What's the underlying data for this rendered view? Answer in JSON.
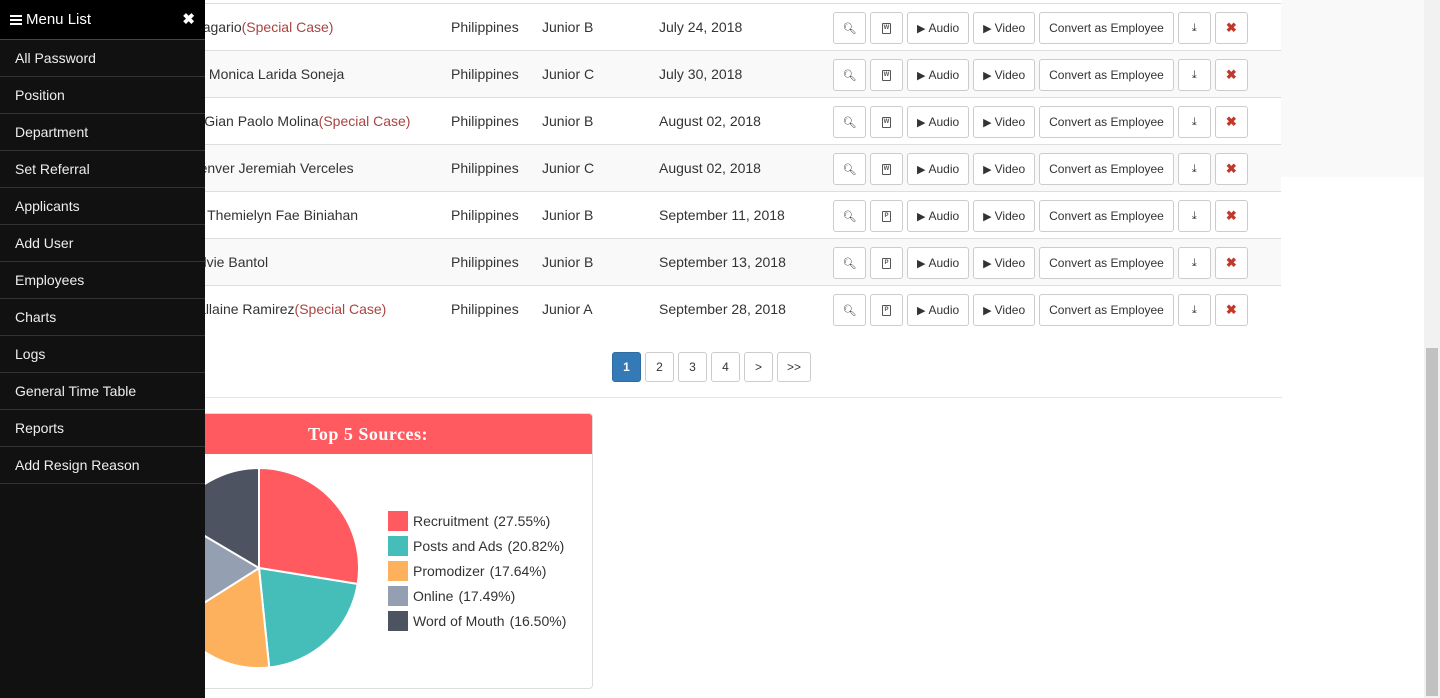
{
  "sidebar": {
    "title": "Menu List",
    "close": "✖",
    "items": [
      {
        "label": "All Password",
        "dropdown": false
      },
      {
        "label": "Position",
        "dropdown": false
      },
      {
        "label": "Department",
        "dropdown": false
      },
      {
        "label": "Set Referral",
        "dropdown": false
      },
      {
        "label": "Applicants",
        "dropdown": true
      },
      {
        "label": "Add User",
        "dropdown": false
      },
      {
        "label": "Employees",
        "dropdown": true
      },
      {
        "label": "Charts",
        "dropdown": false
      },
      {
        "label": "Logs",
        "dropdown": false
      },
      {
        "label": "General Time Table",
        "dropdown": false
      },
      {
        "label": "Reports",
        "dropdown": false
      },
      {
        "label": "Add Resign Reason",
        "dropdown": false
      }
    ]
  },
  "table": {
    "rows": [
      {
        "name": "Randy Sagario",
        "special": "(Special Case)",
        "country": "Philippines",
        "level": "Junior B",
        "date": "July 24, 2018",
        "doc": "W"
      },
      {
        "name": "Campos, Monica Larida Soneja",
        "special": "",
        "country": "Philippines",
        "level": "Junior C",
        "date": "July 30, 2018",
        "doc": "W"
      },
      {
        "name": "Pambid, Gian Paolo Molina",
        "special": "(Special Case)",
        "country": "Philippines",
        "level": "Junior B",
        "date": "August 02, 2018",
        "doc": "W"
      },
      {
        "name": "Ebba, Denver Jeremiah Verceles",
        "special": "",
        "country": "Philippines",
        "level": "Junior C",
        "date": "August 02, 2018",
        "doc": "W"
      },
      {
        "name": "Accatan, Themielyn Fae Biniahan",
        "special": "",
        "country": "Philippines",
        "level": "Junior B",
        "date": "September 11, 2018",
        "doc": "P"
      },
      {
        "name": "Monzi, Elvie Bantol",
        "special": "",
        "country": "Philippines",
        "level": "Junior B",
        "date": "September 13, 2018",
        "doc": "P"
      },
      {
        "name": "Lucio, Lallaine Ramirez",
        "special": "(Special Case)",
        "country": "Philippines",
        "level": "Junior A",
        "date": "September 28, 2018",
        "doc": "P"
      }
    ],
    "buttons": {
      "audio": "Audio",
      "video": "Video",
      "convert": "Convert as Employee"
    }
  },
  "pagination": {
    "pages": [
      "1",
      "2",
      "3",
      "4",
      ">",
      ">>"
    ],
    "active": "1"
  },
  "panel": {
    "title": "Top 5 Sources:"
  },
  "chart_data": {
    "type": "pie",
    "title": "Top 5 Sources:",
    "series": [
      {
        "name": "Recruitment",
        "value": 27.55,
        "label": "(27.55%)",
        "color": "#ff5a5f"
      },
      {
        "name": "Posts and Ads",
        "value": 20.82,
        "label": "(20.82%)",
        "color": "#45bdb8"
      },
      {
        "name": "Promodizer",
        "value": 17.64,
        "label": "(17.64%)",
        "color": "#fdb15d"
      },
      {
        "name": "Online",
        "value": 17.49,
        "label": "(17.49%)",
        "color": "#949fb1"
      },
      {
        "name": "Word of Mouth",
        "value": 16.5,
        "label": "(16.50%)",
        "color": "#4d5360"
      }
    ],
    "legend": "right"
  }
}
